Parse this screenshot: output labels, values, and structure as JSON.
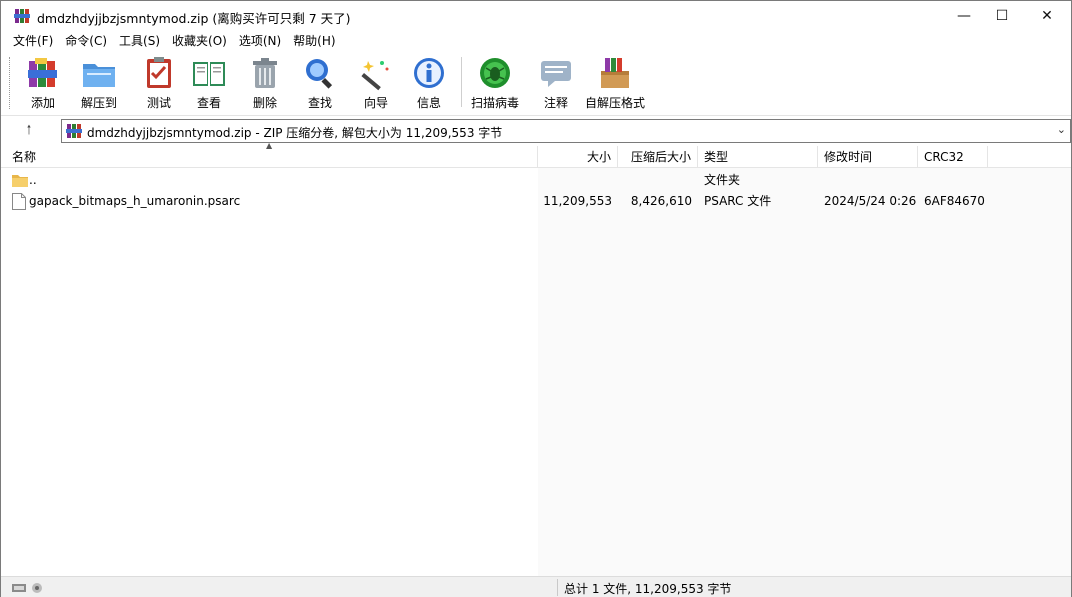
{
  "window": {
    "title": "dmdzhdyjjbzjsmntymod.zip (离购买许可只剩 7 天了)",
    "icons": {
      "app": "winrar-books-icon",
      "minimize": "minimize-icon",
      "maximize": "maximize-icon",
      "close": "close-icon"
    }
  },
  "menu": [
    "文件(F)",
    "命令(C)",
    "工具(S)",
    "收藏夹(O)",
    "选项(N)",
    "帮助(H)"
  ],
  "toolbar": [
    {
      "label": "添加",
      "icon": "add-archive-icon"
    },
    {
      "label": "解压到",
      "icon": "extract-folder-icon"
    },
    {
      "label": "测试",
      "icon": "test-clipboard-icon"
    },
    {
      "label": "查看",
      "icon": "view-book-icon"
    },
    {
      "label": "删除",
      "icon": "delete-trash-icon"
    },
    {
      "label": "查找",
      "icon": "find-magnifier-icon"
    },
    {
      "label": "向导",
      "icon": "wizard-wand-icon"
    },
    {
      "label": "信息",
      "icon": "info-icon"
    },
    {
      "label": "扫描病毒",
      "icon": "virus-scan-icon"
    },
    {
      "label": "注释",
      "icon": "comment-icon"
    },
    {
      "label": "自解压格式",
      "icon": "sfx-box-icon"
    }
  ],
  "address": {
    "text": "dmdzhdyjjbzjsmntymod.zip - ZIP 压缩分卷, 解包大小为 11,209,553 字节",
    "up_icon": "up-arrow-icon",
    "dropdown_icon": "chevron-down-icon"
  },
  "columns": [
    "名称",
    "大小",
    "压缩后大小",
    "类型",
    "修改时间",
    "CRC32"
  ],
  "rows": [
    {
      "name": "..",
      "size": "",
      "packed": "",
      "type": "文件夹",
      "modified": "",
      "crc": "",
      "icon": "folder-icon"
    },
    {
      "name": "gapack_bitmaps_h_umaronin.psarc",
      "size": "11,209,553",
      "packed": "8,426,610",
      "type": "PSARC 文件",
      "modified": "2024/5/24 0:26",
      "crc": "6AF84670",
      "icon": "file-icon"
    }
  ],
  "status": {
    "text": "总计 1 文件, 11,209,553 字节",
    "icons": "drive-status-icon"
  },
  "colors": {
    "selection": "#cce8ff",
    "window_bg": "#ffffff",
    "statusbar_bg": "#f0f0f0"
  }
}
